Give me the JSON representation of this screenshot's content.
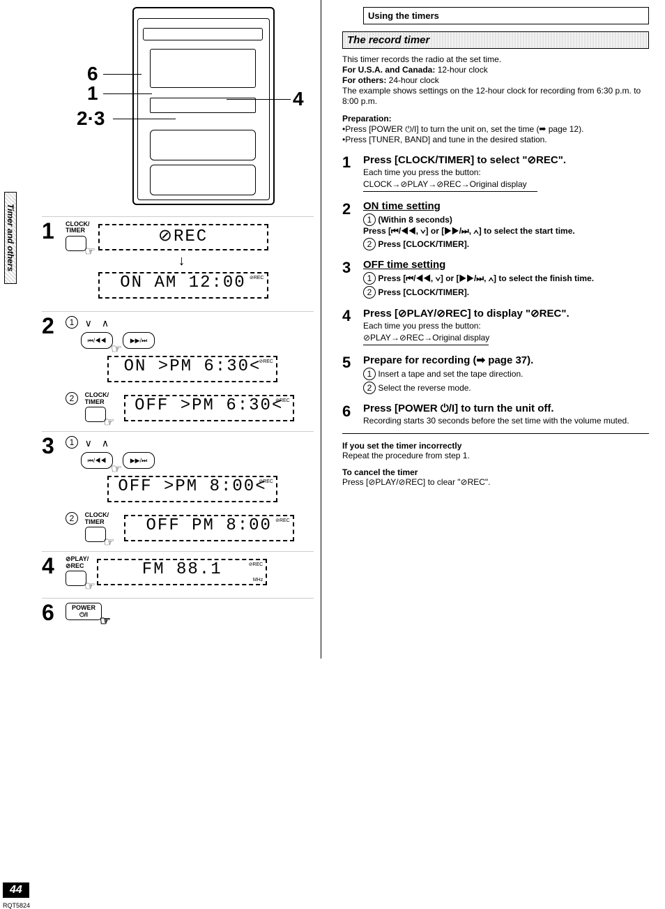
{
  "sideTab": "Timer and others",
  "pageNumber": "44",
  "rqt": "RQT5824",
  "stereo": {
    "callouts": [
      "6",
      "1",
      "2·3",
      "4"
    ]
  },
  "leftSteps": {
    "s1": {
      "num": "1",
      "btnLabel": "CLOCK/\nTIMER",
      "lcd1": "⊘REC",
      "lcd2": "ON   AM 12:00",
      "lcdTag": "⊘REC"
    },
    "s2": {
      "num": "2",
      "lcd1": "ON  >PM  6:30<",
      "btnLabel": "CLOCK/\nTIMER",
      "lcd2": "OFF >PM  6:30<",
      "lcdTag": "⊘REC"
    },
    "s3": {
      "num": "3",
      "lcd1": "OFF >PM  8:00<",
      "btnLabel": "CLOCK/\nTIMER",
      "lcd2": "OFF  PM  8:00",
      "lcdTag": "⊘REC"
    },
    "s4": {
      "num": "4",
      "btnLabel": "⊘PLAY/\n⊘REC",
      "lcd": "FM   88.1",
      "lcdTag1": "⊘REC",
      "lcdTag2": "MHz"
    },
    "s6": {
      "num": "6",
      "btnLabel": "POWER\n⏻/I"
    }
  },
  "right": {
    "usingTheTimers": "Using the timers",
    "recordTimerTitle": "The record timer",
    "intro": [
      "This timer records the radio at the set time.",
      "For U.S.A. and Canada: 12-hour clock",
      "For others: 24-hour clock",
      "The example shows settings on the 12-hour clock for recording from 6:30 p.m. to 8:00 p.m."
    ],
    "prep": {
      "title": "Preparation:",
      "b1": "•Press [POWER ⏻/I] to turn the unit on, set the time (➡ page 12).",
      "b2": "•Press [TUNER, BAND] and tune in the desired station."
    },
    "step1": {
      "num": "1",
      "title": "Press [CLOCK/TIMER] to select \"⊘REC\".",
      "l1": "Each time you press the button:",
      "l2": "CLOCK→⊘PLAY→⊘REC→Original display"
    },
    "step2": {
      "num": "2",
      "title": "ON time setting",
      "c1": "(Within 8 seconds)\nPress [⏮/◀◀, ∨] or [▶▶/⏭, ∧] to select the start time.",
      "c2": "Press [CLOCK/TIMER]."
    },
    "step3": {
      "num": "3",
      "title": "OFF time setting",
      "c1": "Press [⏮/◀◀, ∨] or [▶▶/⏭, ∧] to select the finish time.",
      "c2": "Press [CLOCK/TIMER]."
    },
    "step4": {
      "num": "4",
      "title": "Press [⊘PLAY/⊘REC] to display \"⊘REC\".",
      "l1": "Each time you press the button:",
      "l2": "⊘PLAY→⊘REC→Original display"
    },
    "step5": {
      "num": "5",
      "title": "Prepare for recording (➡ page 37).",
      "c1": "Insert a tape and set the tape direction.",
      "c2": "Select the reverse mode."
    },
    "step6": {
      "num": "6",
      "title": "Press [POWER ⏻/I] to turn the unit off.",
      "l1": "Recording starts 30 seconds before the set time with the volume muted."
    },
    "incorrect": {
      "title": "If you set the timer incorrectly",
      "body": "Repeat the procedure from step 1."
    },
    "cancel": {
      "title": "To cancel the timer",
      "body": "Press [⊘PLAY/⊘REC] to clear \"⊘REC\"."
    }
  }
}
